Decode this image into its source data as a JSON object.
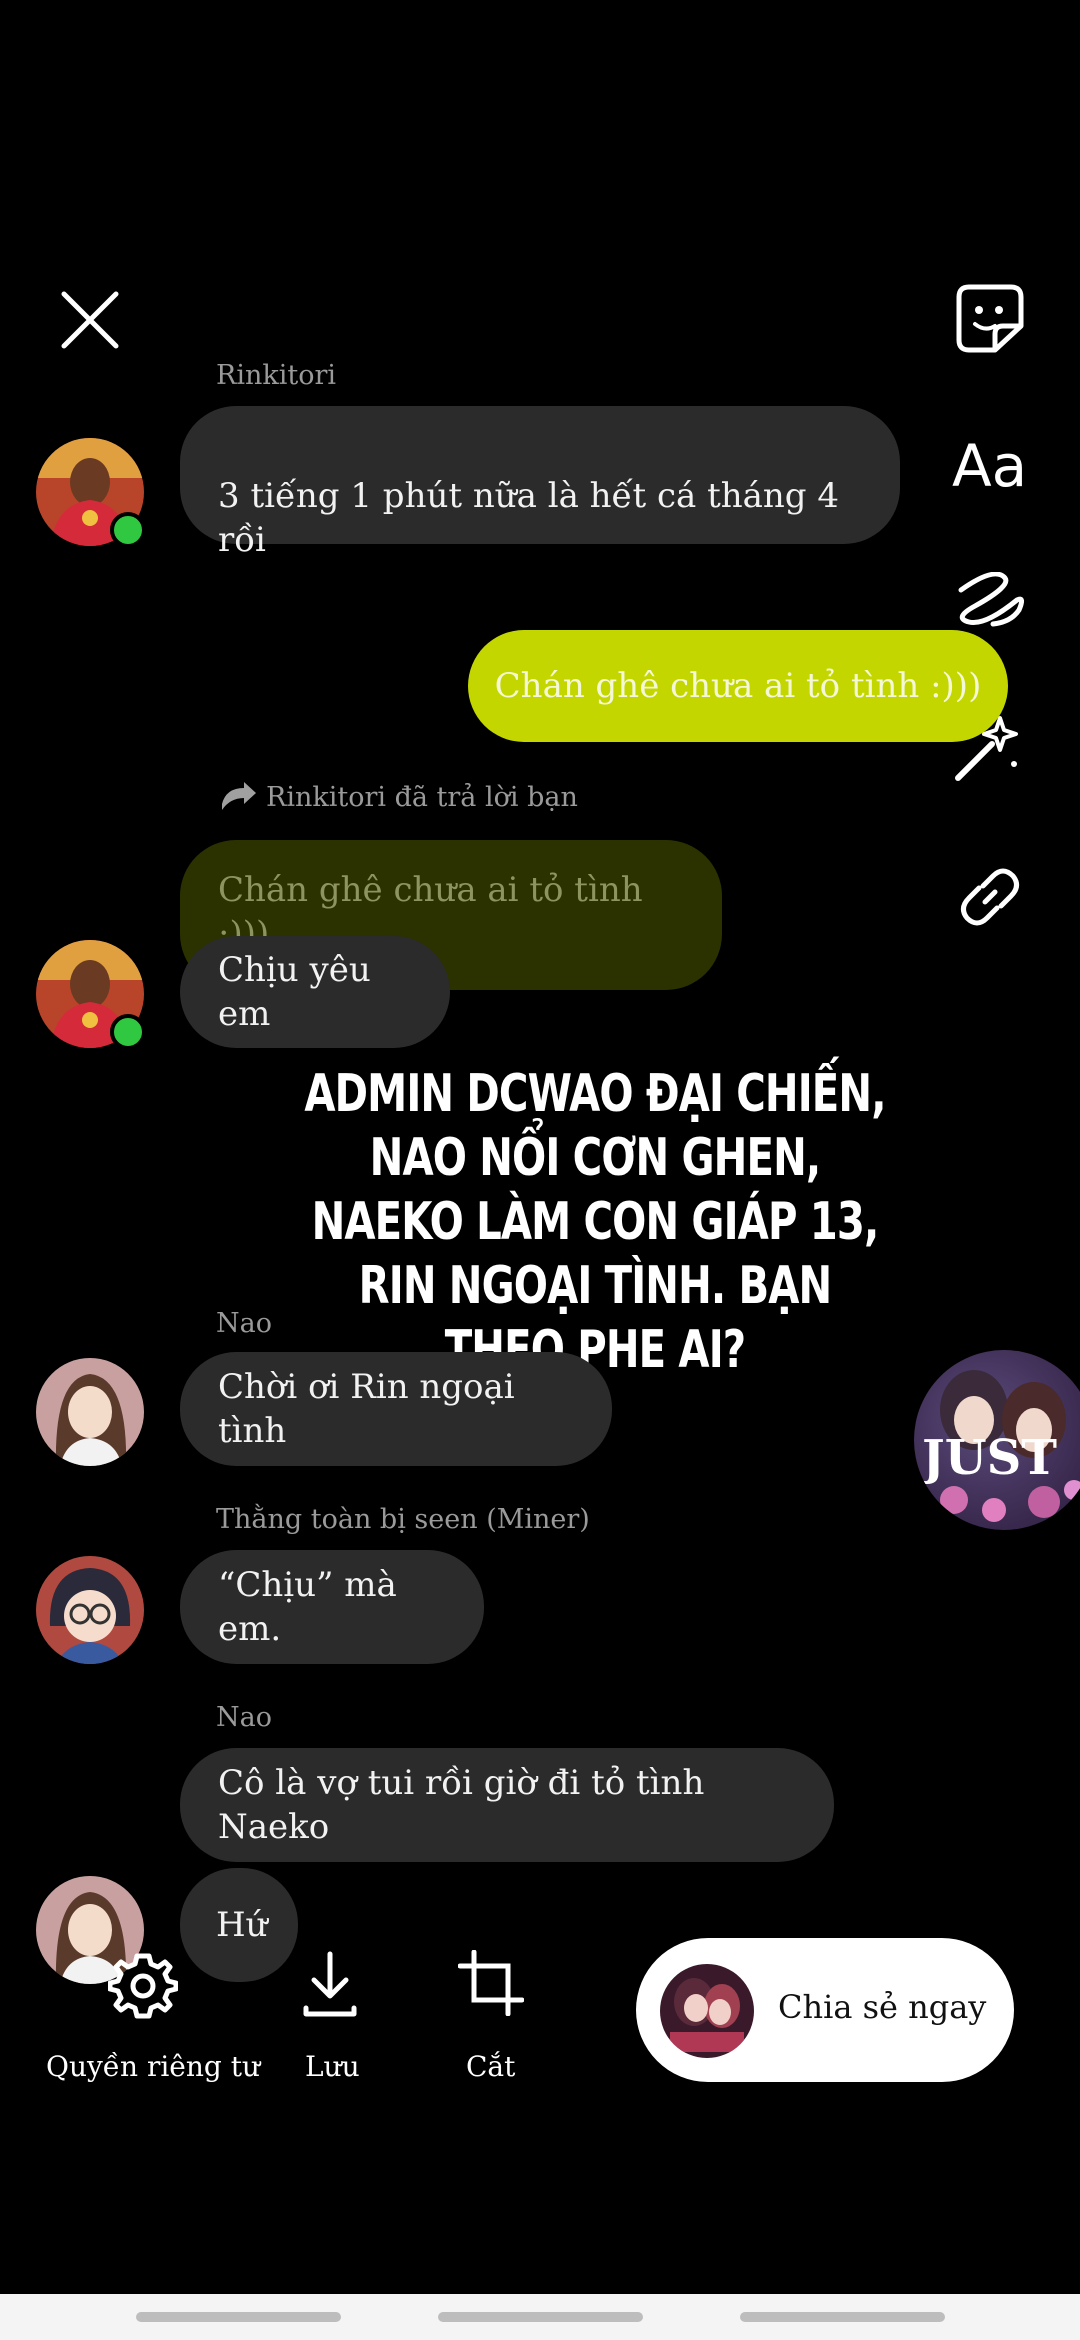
{
  "editor": {
    "close_icon": "close-icon",
    "tools": [
      {
        "name": "sticker-icon"
      },
      {
        "name": "text-tool",
        "label": "Aa"
      },
      {
        "name": "draw-icon"
      },
      {
        "name": "effects-icon"
      },
      {
        "name": "link-icon"
      }
    ]
  },
  "chat": {
    "msg1": {
      "sender": "Rinkitori",
      "text": "3 tiếng 1 phút nữa là hết cá tháng 4\nrồi"
    },
    "msg2": {
      "text": "Chán ghê chưa ai tỏ tình :)))",
      "color": "#c3d600"
    },
    "reply_note": "Rinkitori đã trả lời bạn",
    "reply_quote": "Chán ghê chưa ai tỏ tình :)))",
    "msg3": {
      "text": "Chịu yêu em"
    },
    "msg4": {
      "sender": "Nao",
      "text": "Chời ơi Rin ngoại tình"
    },
    "msg5": {
      "sender": "Thằng toàn bị seen (Miner)",
      "text": "“Chịu” mà em."
    },
    "msg6": {
      "sender": "Nao",
      "text": "Cô là vợ tui rồi giờ đi tỏ tình Naeko"
    },
    "msg7": {
      "text": "Hứ"
    }
  },
  "overlay_caption": "ADMIN DCWAO ĐẠI CHIẾN, NAO NỔI CƠN GHEN, NAEKO LÀM CON GIÁP 13, RIN NGOẠI TÌNH. BẠN THEO PHE AI?",
  "sticker_text": "JUST",
  "bottom": {
    "privacy_label": "Quyền riêng tư",
    "save_label": "Lưu",
    "crop_label": "Cắt",
    "share_label": "Chia sẻ ngay"
  }
}
